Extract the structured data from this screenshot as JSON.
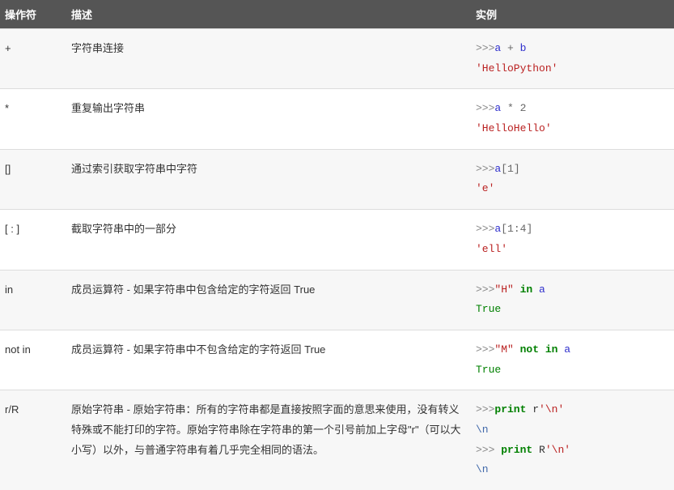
{
  "headers": {
    "operator": "操作符",
    "description": "描述",
    "example": "实例"
  },
  "rows": [
    {
      "operator": "+",
      "description": "字符串连接",
      "code": [
        [
          {
            "t": ">>>",
            "c": "c-prompt"
          },
          {
            "t": "a",
            "c": "c-var"
          },
          {
            "t": " + ",
            "c": "c-op"
          },
          {
            "t": "b",
            "c": "c-var"
          }
        ],
        [
          {
            "t": "'HelloPython'",
            "c": "c-str"
          }
        ]
      ]
    },
    {
      "operator": "*",
      "description": "重复输出字符串",
      "code": [
        [
          {
            "t": ">>>",
            "c": "c-prompt"
          },
          {
            "t": "a",
            "c": "c-var"
          },
          {
            "t": " * ",
            "c": "c-op"
          },
          {
            "t": "2",
            "c": "c-num"
          }
        ],
        [
          {
            "t": "'HelloHello'",
            "c": "c-str"
          }
        ]
      ]
    },
    {
      "operator": "[]",
      "description": "通过索引获取字符串中字符",
      "code": [
        [
          {
            "t": ">>>",
            "c": "c-prompt"
          },
          {
            "t": "a",
            "c": "c-var"
          },
          {
            "t": "[",
            "c": "c-brkt"
          },
          {
            "t": "1",
            "c": "c-num"
          },
          {
            "t": "]",
            "c": "c-brkt"
          }
        ],
        [
          {
            "t": "'e'",
            "c": "c-str"
          }
        ]
      ]
    },
    {
      "operator": "[ : ]",
      "description": "截取字符串中的一部分",
      "code": [
        [
          {
            "t": ">>>",
            "c": "c-prompt"
          },
          {
            "t": "a",
            "c": "c-var"
          },
          {
            "t": "[",
            "c": "c-brkt"
          },
          {
            "t": "1",
            "c": "c-num"
          },
          {
            "t": ":",
            "c": "c-brkt"
          },
          {
            "t": "4",
            "c": "c-num"
          },
          {
            "t": "]",
            "c": "c-brkt"
          }
        ],
        [
          {
            "t": "'ell'",
            "c": "c-str"
          }
        ]
      ]
    },
    {
      "operator": "in",
      "description": "成员运算符 - 如果字符串中包含给定的字符返回 True",
      "code": [
        [
          {
            "t": ">>>",
            "c": "c-prompt"
          },
          {
            "t": "\"H\"",
            "c": "c-str"
          },
          {
            "t": " in ",
            "c": "c-kw"
          },
          {
            "t": "a",
            "c": "c-var"
          }
        ],
        [
          {
            "t": "True",
            "c": "c-bool"
          }
        ]
      ]
    },
    {
      "operator": "not in",
      "description": "成员运算符 - 如果字符串中不包含给定的字符返回 True",
      "code": [
        [
          {
            "t": ">>>",
            "c": "c-prompt"
          },
          {
            "t": "\"M\"",
            "c": "c-str"
          },
          {
            "t": " not in ",
            "c": "c-kw"
          },
          {
            "t": "a",
            "c": "c-var"
          }
        ],
        [
          {
            "t": "True",
            "c": "c-bool"
          }
        ]
      ]
    },
    {
      "operator": "r/R",
      "description": "原始字符串 - 原始字符串：所有的字符串都是直接按照字面的意思来使用，没有转义特殊或不能打印的字符。原始字符串除在字符串的第一个引号前加上字母\"r\"（可以大小写）以外，与普通字符串有着几乎完全相同的语法。",
      "code": [
        [
          {
            "t": ">>>",
            "c": "c-prompt"
          },
          {
            "t": "print",
            "c": "c-kw"
          },
          {
            "t": " r",
            "c": ""
          },
          {
            "t": "'",
            "c": "c-str"
          },
          {
            "t": "\\n",
            "c": "c-str"
          },
          {
            "t": "'",
            "c": "c-str"
          }
        ],
        [
          {
            "t": "\\n",
            "c": "c-esc"
          }
        ],
        [
          {
            "t": ">>> ",
            "c": "c-prompt"
          },
          {
            "t": "print",
            "c": "c-kw"
          },
          {
            "t": " R",
            "c": ""
          },
          {
            "t": "'",
            "c": "c-str"
          },
          {
            "t": "\\n",
            "c": "c-str"
          },
          {
            "t": "'",
            "c": "c-str"
          }
        ],
        [
          {
            "t": "\\n",
            "c": "c-esc"
          }
        ]
      ]
    }
  ]
}
